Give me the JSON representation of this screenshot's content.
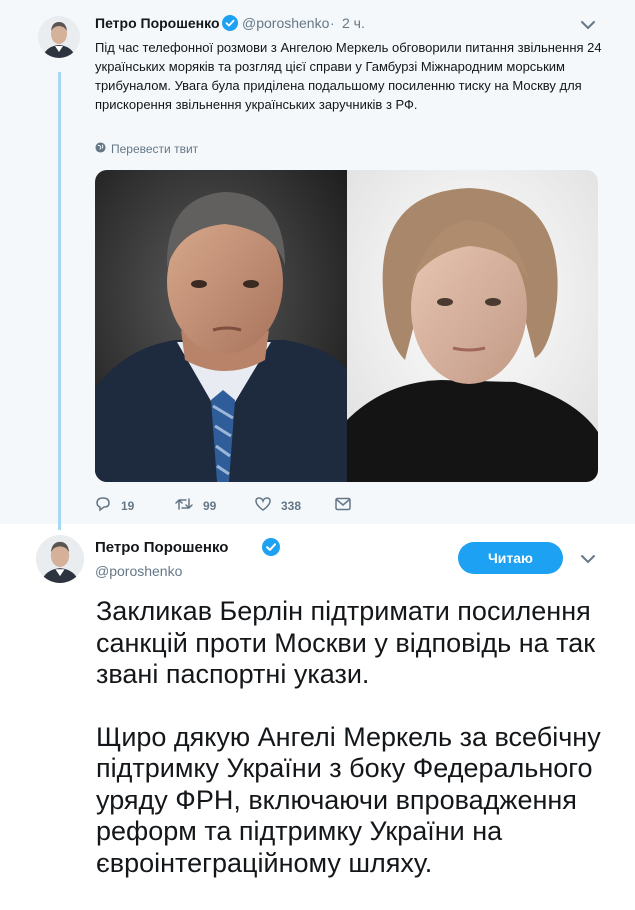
{
  "tweet1": {
    "author_name": "Петро Порошенко",
    "handle": "@poroshenko",
    "separator": "·",
    "time": "2 ч.",
    "text": "Під час телефонної розмови з Ангелою Меркель обговорили питання звільнення 24 українських моряків та розгляд цієї справи у Гамбурзі Міжнародним морським трибуналом. Увага була приділена подальшому посиленню тиску на Москву для прискорення звільнення українських заручників з РФ.",
    "translate_label": "Перевести твит",
    "actions": {
      "replies": "19",
      "retweets": "99",
      "likes": "338"
    },
    "icons": [
      "reply-icon",
      "retweet-icon",
      "like-icon",
      "message-icon",
      "globe-icon",
      "verified-icon",
      "chevron-down-icon"
    ]
  },
  "tweet2": {
    "author_name": "Петро Порошенко",
    "handle": "@poroshenko",
    "follow_label": "Читаю",
    "paragraphs": [
      "Закликав Берлін підтримати посилення санкцій проти Москви у відповідь на так звані паспортні укази.",
      "Щиро дякую Ангелі Меркель за всебічну підтримку України з боку Федерального уряду ФРН, включаючи впровадження реформ та підтримку України на євроінтеграційному шляху."
    ]
  },
  "colors": {
    "accent": "#1da1f2",
    "follow_button": "#1da1f2",
    "thread_line": "#a7d9f5",
    "secondary_text": "#657786",
    "tweet1_background": "#f5f8fa"
  }
}
